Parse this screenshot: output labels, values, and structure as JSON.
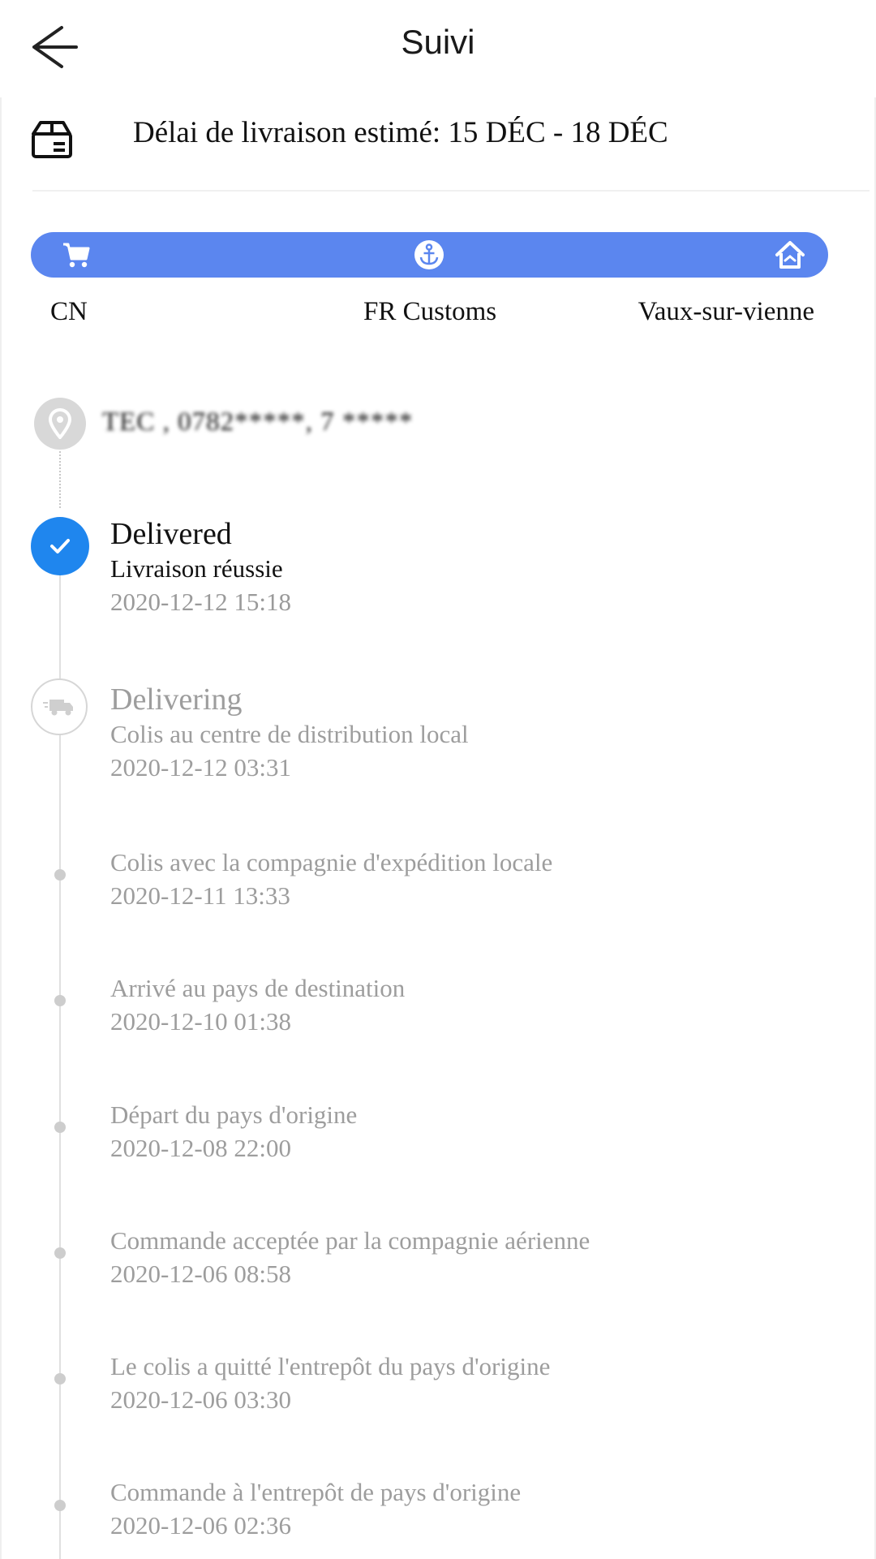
{
  "header": {
    "title": "Suivi",
    "back_icon": "arrow-left-icon"
  },
  "eta": {
    "icon": "package-box-icon",
    "text": "Délai de livraison estimé: 15 DÉC - 18 DÉC"
  },
  "route": {
    "bar_color": "#5b86ef",
    "stops": [
      {
        "icon": "cart-icon",
        "label": "CN"
      },
      {
        "icon": "anchor-icon",
        "label": "FR Customs"
      },
      {
        "icon": "home-icon",
        "label": "Vaux-sur-vienne"
      }
    ]
  },
  "address": {
    "icon": "location-pin-icon",
    "text": "TEC    , 0782*****, 7     ***** "
  },
  "status_colors": {
    "active": "#1f86ee",
    "muted": "#9d9d9d"
  },
  "timeline": [
    {
      "title": "Delivered",
      "desc": "Livraison réussie",
      "time": "2020-12-12 15:18"
    },
    {
      "title": "Delivering",
      "desc": "Colis au centre de distribution local",
      "time": "2020-12-12 03:31"
    },
    {
      "desc": "Colis avec la compagnie d'expédition locale",
      "time": "2020-12-11 13:33"
    },
    {
      "desc": "Arrivé au pays de destination",
      "time": "2020-12-10 01:38"
    },
    {
      "desc": "Départ du pays d'origine",
      "time": "2020-12-08 22:00"
    },
    {
      "desc": "Commande acceptée par la compagnie aérienne",
      "time": "2020-12-06 08:58"
    },
    {
      "desc": "Le colis a quitté l'entrepôt du pays d'origine",
      "time": "2020-12-06 03:30"
    },
    {
      "desc": "Commande à l'entrepôt de pays d'origine",
      "time": "2020-12-06 02:36"
    }
  ]
}
